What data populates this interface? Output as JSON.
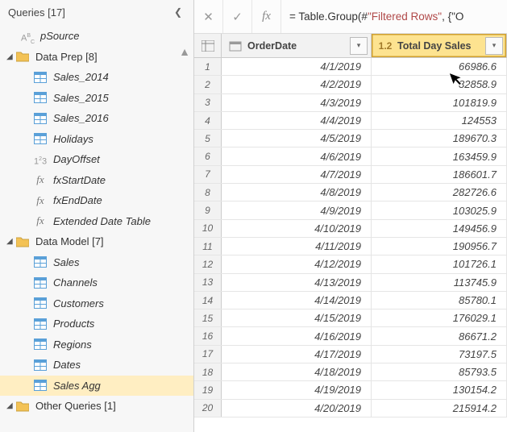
{
  "sidebar": {
    "title": "Queries [17]",
    "groups": [
      {
        "type": "item",
        "indent": 1,
        "icon": "txt",
        "label": "pSource"
      },
      {
        "type": "folder",
        "indent": 0,
        "label": "Data Prep [8]",
        "expanded": true
      },
      {
        "type": "item",
        "indent": 2,
        "icon": "table",
        "label": "Sales_2014"
      },
      {
        "type": "item",
        "indent": 2,
        "icon": "table",
        "label": "Sales_2015"
      },
      {
        "type": "item",
        "indent": 2,
        "icon": "table",
        "label": "Sales_2016"
      },
      {
        "type": "item",
        "indent": 2,
        "icon": "table",
        "label": "Holidays"
      },
      {
        "type": "item",
        "indent": 2,
        "icon": "num",
        "label": "DayOffset"
      },
      {
        "type": "item",
        "indent": 2,
        "icon": "fx",
        "label": "fxStartDate"
      },
      {
        "type": "item",
        "indent": 2,
        "icon": "fx",
        "label": "fxEndDate"
      },
      {
        "type": "item",
        "indent": 2,
        "icon": "fx",
        "label": "Extended Date Table"
      },
      {
        "type": "folder",
        "indent": 0,
        "label": "Data Model [7]",
        "expanded": true
      },
      {
        "type": "item",
        "indent": 2,
        "icon": "table",
        "label": "Sales"
      },
      {
        "type": "item",
        "indent": 2,
        "icon": "table",
        "label": "Channels"
      },
      {
        "type": "item",
        "indent": 2,
        "icon": "table",
        "label": "Customers"
      },
      {
        "type": "item",
        "indent": 2,
        "icon": "table",
        "label": "Products"
      },
      {
        "type": "item",
        "indent": 2,
        "icon": "table",
        "label": "Regions"
      },
      {
        "type": "item",
        "indent": 2,
        "icon": "table",
        "label": "Dates"
      },
      {
        "type": "item",
        "indent": 2,
        "icon": "table",
        "label": "Sales Agg",
        "selected": true
      },
      {
        "type": "folder",
        "indent": 0,
        "label": "Other Queries [1]",
        "expanded": true
      }
    ]
  },
  "formula": {
    "prefix": "= Table.Group(#",
    "string": "\"Filtered Rows\"",
    "suffix": ", {\"O"
  },
  "columns": {
    "col1": {
      "type": "date",
      "label": "OrderDate"
    },
    "col2": {
      "type": "decimal",
      "label": "Total Day Sales",
      "selected": true
    }
  },
  "chart_data": {
    "type": "table",
    "columns": [
      "OrderDate",
      "Total Day Sales"
    ],
    "rows": [
      [
        "4/1/2019",
        "66986.6"
      ],
      [
        "4/2/2019",
        "82858.9"
      ],
      [
        "4/3/2019",
        "101819.9"
      ],
      [
        "4/4/2019",
        "124553"
      ],
      [
        "4/5/2019",
        "189670.3"
      ],
      [
        "4/6/2019",
        "163459.9"
      ],
      [
        "4/7/2019",
        "186601.7"
      ],
      [
        "4/8/2019",
        "282726.6"
      ],
      [
        "4/9/2019",
        "103025.9"
      ],
      [
        "4/10/2019",
        "149456.9"
      ],
      [
        "4/11/2019",
        "190956.7"
      ],
      [
        "4/12/2019",
        "101726.1"
      ],
      [
        "4/13/2019",
        "113745.9"
      ],
      [
        "4/14/2019",
        "85780.1"
      ],
      [
        "4/15/2019",
        "176029.1"
      ],
      [
        "4/16/2019",
        "86671.2"
      ],
      [
        "4/17/2019",
        "73197.5"
      ],
      [
        "4/18/2019",
        "85793.5"
      ],
      [
        "4/19/2019",
        "130154.2"
      ],
      [
        "4/20/2019",
        "215914.2"
      ]
    ]
  }
}
